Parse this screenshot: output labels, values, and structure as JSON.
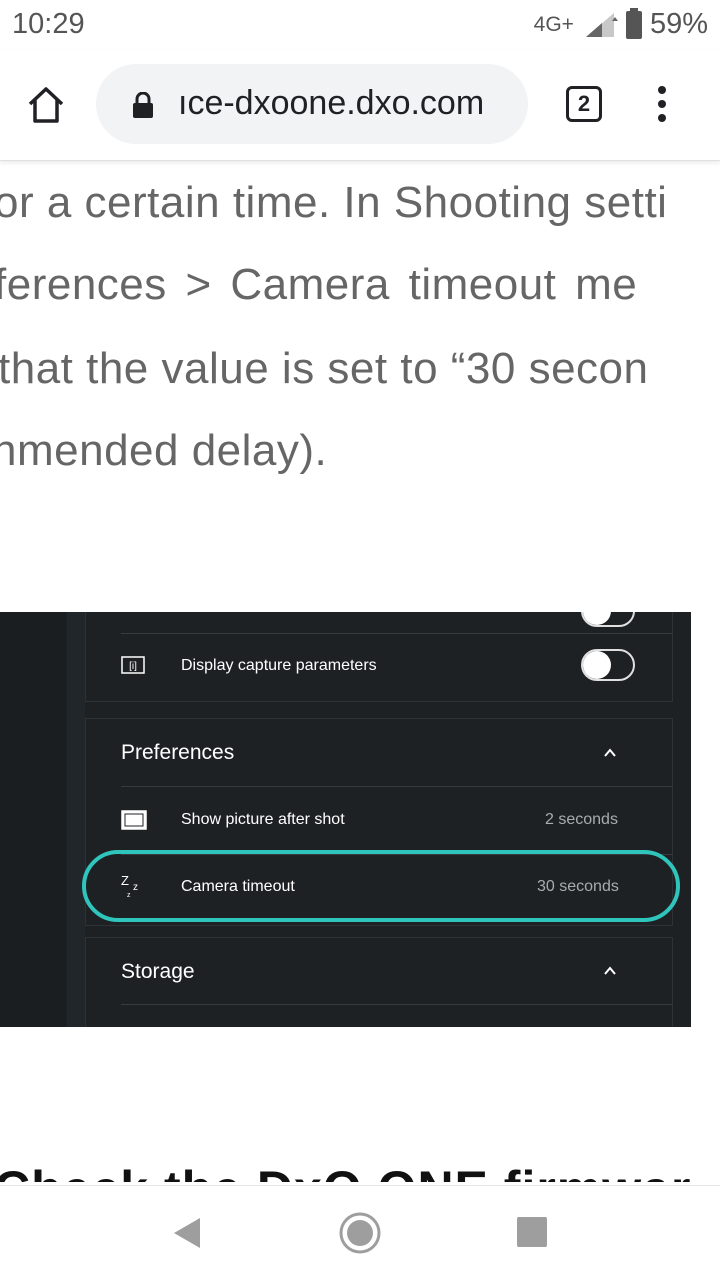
{
  "status": {
    "time": "10:29",
    "network": "4G+",
    "battery": "59%"
  },
  "browser": {
    "url": "ıce-dxoone.dxo.com",
    "tab_count": "2"
  },
  "article": {
    "lines": [
      "or a certain time. In Shooting setti",
      "ferences  >  Camera  timeout  me",
      "that the value is set to “30 secon",
      "nmended delay)."
    ],
    "next_heading": "Check the DxO ONE firmwar"
  },
  "screenshot": {
    "display_capture": "Display capture parameters",
    "preferences_title": "Preferences",
    "show_picture_label": "Show picture after shot",
    "show_picture_value": "2 seconds",
    "camera_timeout_label": "Camera timeout",
    "camera_timeout_value": "30 seconds",
    "storage_title": "Storage",
    "highlight_color": "#2fc4bc",
    "display_capture_toggle": "off"
  }
}
